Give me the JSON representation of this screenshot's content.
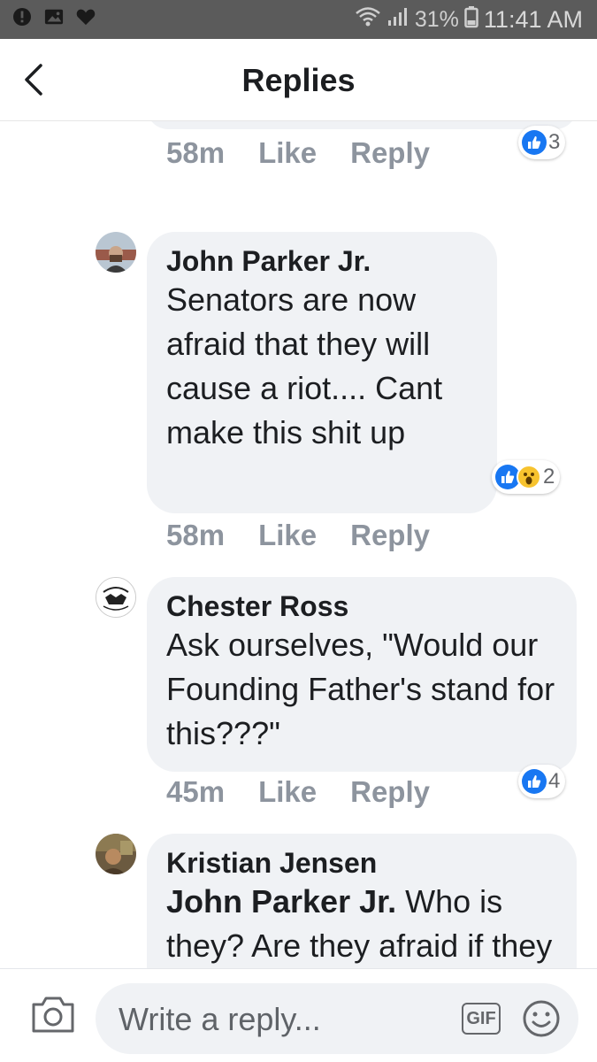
{
  "status_bar": {
    "battery_percent": "31%",
    "time": "11:41 AM",
    "icons": [
      "alert-icon",
      "image-icon",
      "heart-icon",
      "wifi-icon",
      "signal-icon",
      "battery-icon"
    ]
  },
  "header": {
    "title": "Replies",
    "back_icon": "chevron-left-icon"
  },
  "comments": [
    {
      "author": "",
      "time": "58m",
      "like_label": "Like",
      "reply_label": "Reply",
      "reaction_count": "3",
      "reactions": [
        "like"
      ]
    },
    {
      "author": "John Parker Jr.",
      "text": "Senators are now afraid that they will cause a riot.... Cant make this shit up",
      "time": "58m",
      "like_label": "Like",
      "reply_label": "Reply",
      "reaction_count": "2",
      "reactions": [
        "like",
        "wow"
      ]
    },
    {
      "author": "Chester Ross",
      "text": "Ask ourselves, \"Would our Founding Father's stand for this???\"",
      "time": "45m",
      "like_label": "Like",
      "reply_label": "Reply",
      "reaction_count": "4",
      "reactions": [
        "like"
      ]
    },
    {
      "author": "Kristian Jensen",
      "mention": "John Parker Jr.",
      "text": "Who is they? Are they afraid if they show up that’s",
      "reactions": []
    }
  ],
  "footer": {
    "placeholder": "Write a reply...",
    "gif_label": "GIF",
    "icons": [
      "camera-icon",
      "gif-icon",
      "emoji-icon"
    ]
  },
  "colors": {
    "bubble": "#f0f2f5",
    "meta_text": "#8d949e",
    "like_blue": "#1877f2",
    "status_bar": "#5b5b5b"
  }
}
